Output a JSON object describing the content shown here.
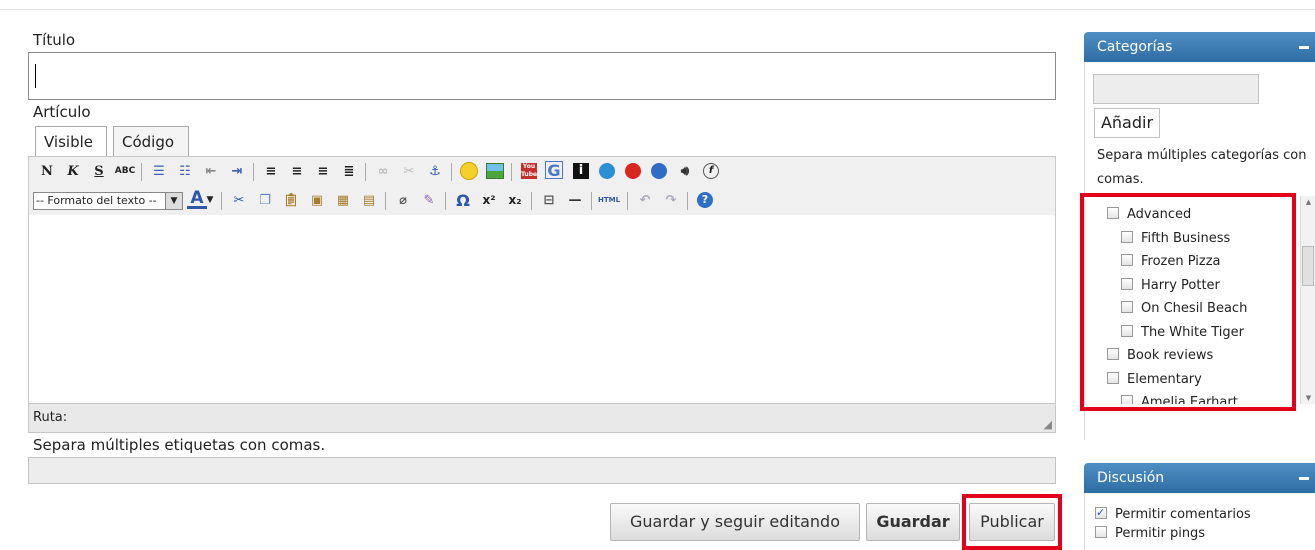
{
  "editor": {
    "title_label": "Título",
    "title_value": "",
    "article_label": "Artículo",
    "tabs": [
      "Visible",
      "Código"
    ],
    "format_select": "-- Formato del texto --",
    "path_label": "Ruta:",
    "tags_hint": "Separa múltiples etiquetas con comas.",
    "tags_value": ""
  },
  "toolbar_row1": [
    "bold",
    "italic",
    "strikethrough",
    "spellcheck",
    "unordered-list",
    "ordered-list",
    "outdent",
    "indent",
    "align-left",
    "align-center",
    "align-right",
    "justify",
    "link",
    "unlink",
    "anchor",
    "emoticon",
    "image",
    "youtube",
    "google",
    "info",
    "quicktime",
    "real-media",
    "windows-media",
    "audio",
    "flash"
  ],
  "toolbar_row2": [
    "font-color",
    "cut",
    "copy",
    "paste",
    "paste-text",
    "paste-word",
    "paste-table",
    "eraser",
    "cleanup",
    "special-char",
    "superscript",
    "subscript",
    "page-break",
    "horizontal-rule",
    "html-source",
    "undo",
    "redo",
    "help"
  ],
  "actions": {
    "save_continue": "Guardar y seguir editando",
    "save": "Guardar",
    "publish": "Publicar"
  },
  "categories": {
    "title": "Categorías",
    "input_value": "",
    "add_button": "Añadir",
    "hint": "Separa múltiples categorías con comas.",
    "items": [
      {
        "label": "Advanced",
        "level": 0,
        "checked": false
      },
      {
        "label": "Fifth Business",
        "level": 1,
        "checked": false
      },
      {
        "label": "Frozen Pizza",
        "level": 1,
        "checked": false
      },
      {
        "label": "Harry Potter",
        "level": 1,
        "checked": false
      },
      {
        "label": "On Chesil Beach",
        "level": 1,
        "checked": false
      },
      {
        "label": "The White Tiger",
        "level": 1,
        "checked": false
      },
      {
        "label": "Book reviews",
        "level": 0,
        "checked": false
      },
      {
        "label": "Elementary",
        "level": 0,
        "checked": false
      },
      {
        "label": "Amelia Earhart",
        "level": 1,
        "checked": false
      }
    ]
  },
  "discussion": {
    "title": "Discusión",
    "allow_comments": "Permitir comentarios",
    "allow_comments_checked": true,
    "allow_pings": "Permitir pings",
    "allow_pings_checked": false
  },
  "colors": {
    "panel_header": "#2d6da3",
    "highlight": "#e3001b"
  }
}
